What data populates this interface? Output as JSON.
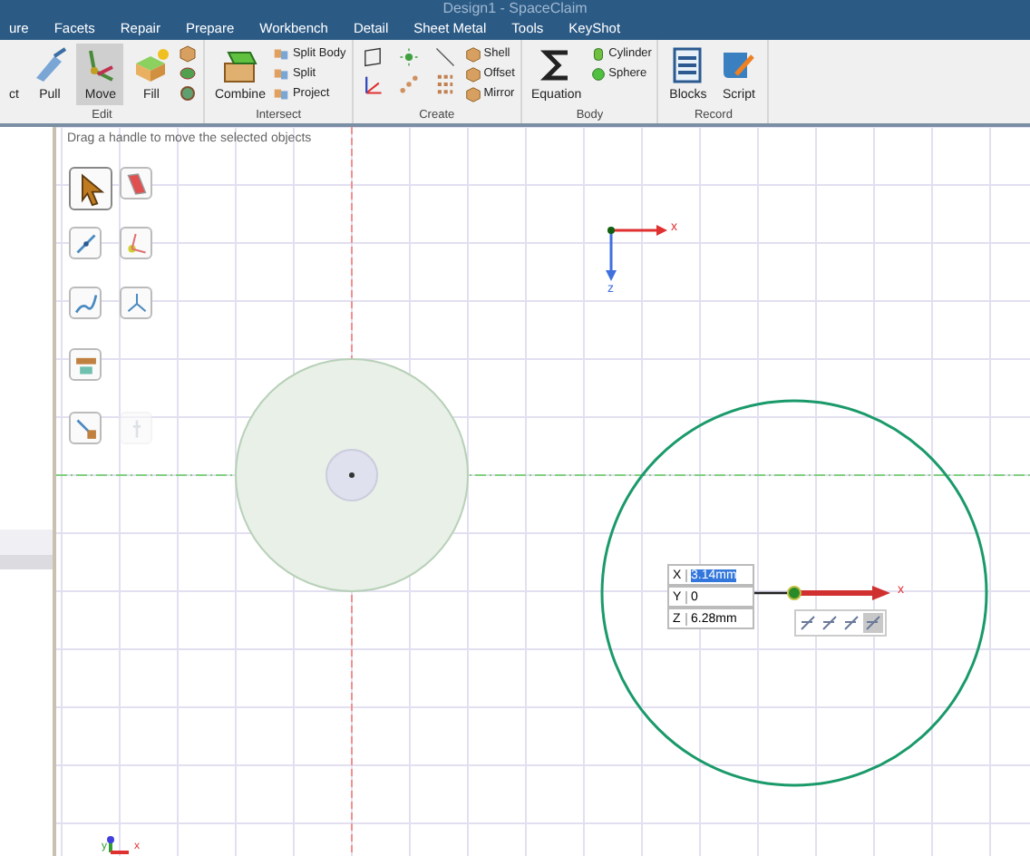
{
  "window": {
    "title": "Design1 - SpaceClaim"
  },
  "menu": [
    {
      "label": "ure",
      "selected": false
    },
    {
      "label": "Facets",
      "selected": false
    },
    {
      "label": "Repair",
      "selected": false
    },
    {
      "label": "Prepare",
      "selected": false
    },
    {
      "label": "Workbench",
      "selected": false
    },
    {
      "label": "Detail",
      "selected": false
    },
    {
      "label": "Sheet Metal",
      "selected": false
    },
    {
      "label": "Tools",
      "selected": false
    },
    {
      "label": "KeyShot",
      "selected": false
    }
  ],
  "ribbon": [
    {
      "label": "Edit",
      "tools": [
        {
          "kind": "large",
          "label": "ct",
          "selected": false
        },
        {
          "kind": "large",
          "label": "Pull",
          "selected": false
        },
        {
          "kind": "large",
          "label": "Move",
          "selected": true
        },
        {
          "kind": "large",
          "label": "Fill",
          "selected": false
        },
        {
          "kind": "stack"
        }
      ]
    },
    {
      "label": "Intersect",
      "tools": [
        {
          "kind": "large",
          "label": "Combine",
          "selected": false
        },
        {
          "kind": "column",
          "items": [
            {
              "label": "Split Body"
            },
            {
              "label": "Split"
            },
            {
              "label": "Project"
            }
          ]
        }
      ]
    },
    {
      "label": "Create",
      "tools": [
        {
          "kind": "grid"
        },
        {
          "kind": "column",
          "items": [
            {
              "label": "Shell"
            },
            {
              "label": "Offset"
            },
            {
              "label": "Mirror"
            }
          ]
        }
      ]
    },
    {
      "label": "Body",
      "tools": [
        {
          "kind": "large",
          "label": "Equation",
          "selected": false
        },
        {
          "kind": "column",
          "items": [
            {
              "label": "Cylinder"
            },
            {
              "label": "Sphere"
            }
          ]
        }
      ]
    },
    {
      "label": "Record",
      "tools": [
        {
          "kind": "large",
          "label": "Blocks",
          "selected": false
        },
        {
          "kind": "large",
          "label": "Script",
          "selected": false
        }
      ]
    }
  ],
  "canvas": {
    "status": "Drag a handle to move the selected objects",
    "palette": [
      {
        "selected": true,
        "disabled": false
      },
      {
        "selected": false,
        "disabled": false
      },
      {
        "selected": false,
        "disabled": false
      },
      {
        "selected": false,
        "disabled": false
      },
      {
        "selected": false,
        "disabled": false
      },
      {
        "selected": false,
        "disabled": false
      },
      {
        "selected": false,
        "disabled": false
      },
      {
        "selected": false,
        "disabled": false
      },
      {
        "selected": false,
        "disabled": true
      }
    ],
    "axes": [
      {
        "label": "x"
      },
      {
        "label": "z"
      }
    ],
    "handle": {
      "label": "x"
    },
    "fields": [
      {
        "axis": "X",
        "value": "3.14mm",
        "selected": true
      },
      {
        "axis": "Y",
        "value": "0",
        "selected": false
      },
      {
        "axis": "Z",
        "value": "6.28mm",
        "selected": false
      }
    ],
    "toolbar": [
      {
        "selected": false
      },
      {
        "selected": false
      },
      {
        "selected": false
      },
      {
        "selected": true
      }
    ],
    "triad": [
      {
        "label": "y"
      },
      {
        "label": "x"
      }
    ]
  }
}
